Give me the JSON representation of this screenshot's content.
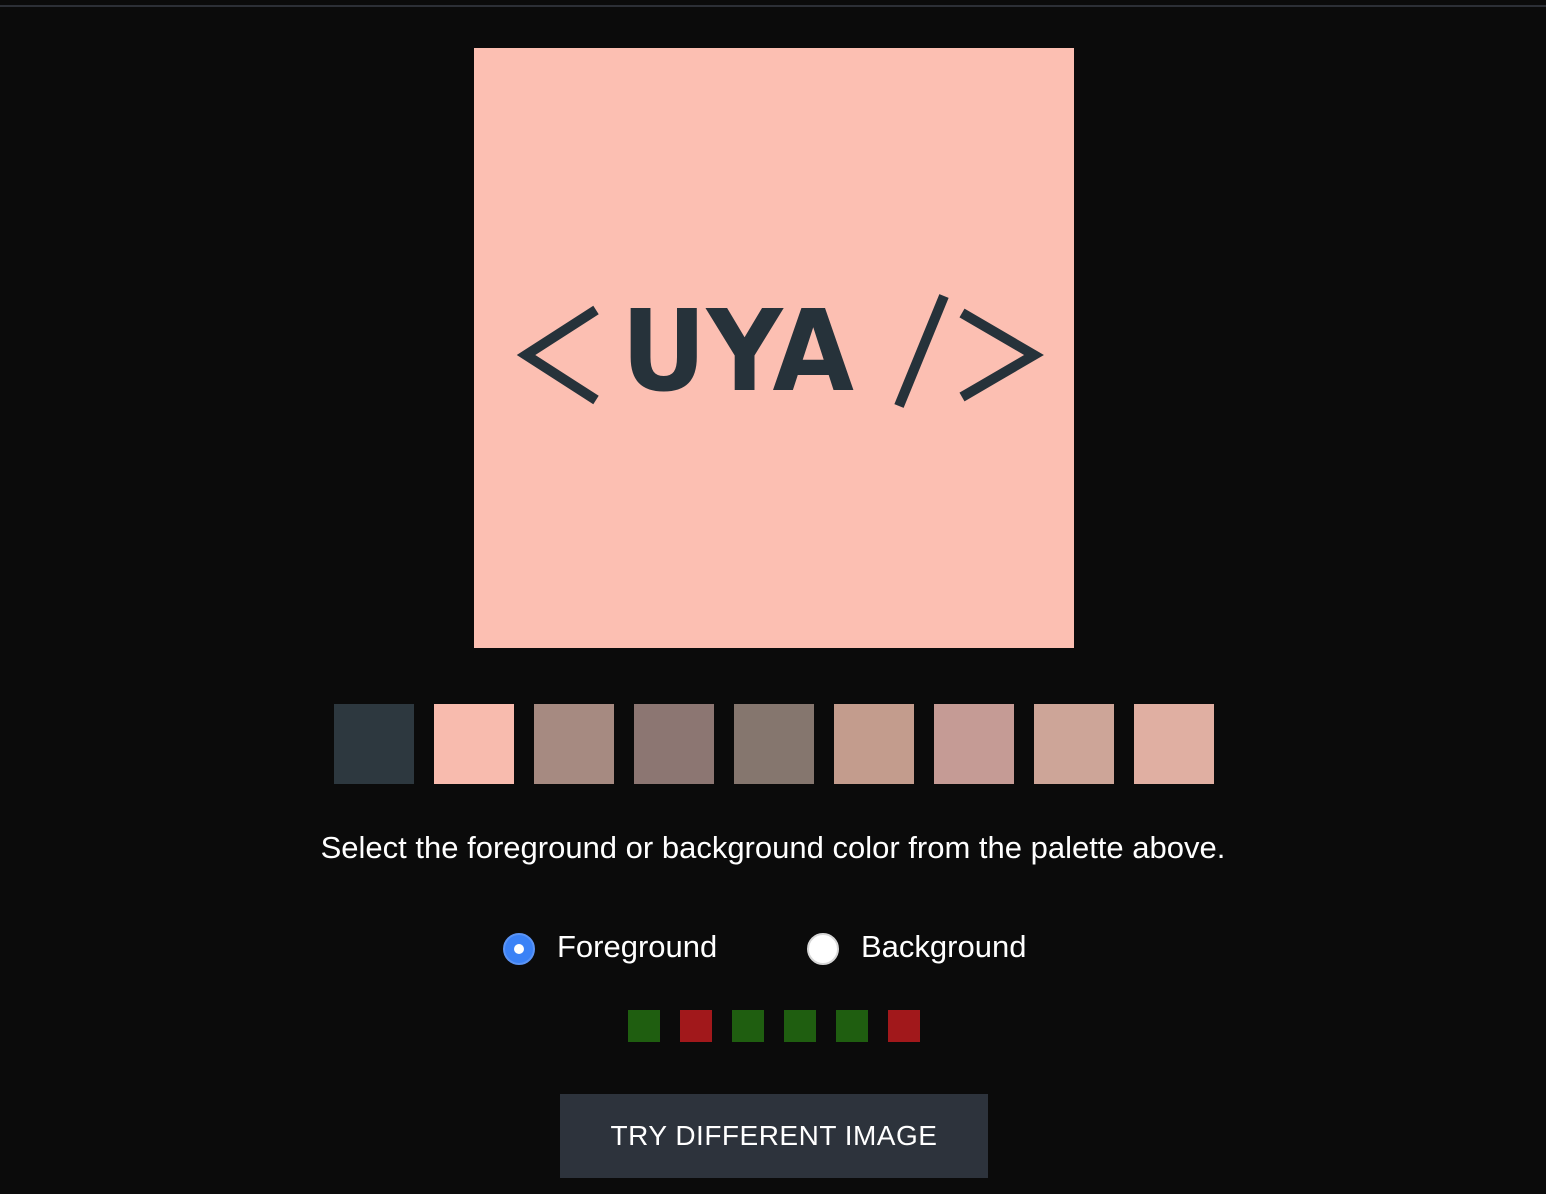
{
  "image": {
    "logo_text": "UYA",
    "background_color": "#fcbfb2",
    "foreground_color": "#26323a"
  },
  "palette": [
    {
      "color": "#2d383f"
    },
    {
      "color": "#f8bbae"
    },
    {
      "color": "#a68a81"
    },
    {
      "color": "#8c7672"
    },
    {
      "color": "#85766e"
    },
    {
      "color": "#c39c8d"
    },
    {
      "color": "#c59b95"
    },
    {
      "color": "#cda598"
    },
    {
      "color": "#e0afa2"
    }
  ],
  "instruction": "Select the foreground or background color from the palette above.",
  "mode": {
    "options": [
      {
        "label": "Foreground",
        "checked": true
      },
      {
        "label": "Background",
        "checked": false
      }
    ]
  },
  "results": [
    {
      "status": "correct",
      "color": "#1f5e10"
    },
    {
      "status": "incorrect",
      "color": "#a1181b"
    },
    {
      "status": "correct",
      "color": "#1f5e10"
    },
    {
      "status": "correct",
      "color": "#1f5e10"
    },
    {
      "status": "correct",
      "color": "#1f5e10"
    },
    {
      "status": "incorrect",
      "color": "#a1181b"
    }
  ],
  "button": {
    "label": "TRY DIFFERENT IMAGE"
  }
}
